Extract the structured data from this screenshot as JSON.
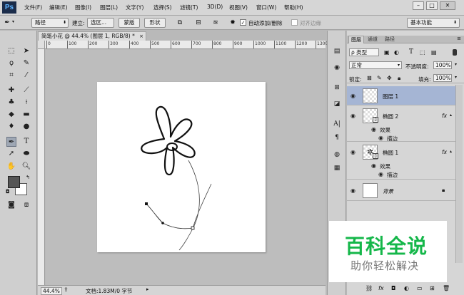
{
  "app": {
    "logo": "Ps"
  },
  "menu": [
    "文件(F)",
    "编辑(E)",
    "图像(I)",
    "图层(L)",
    "文字(Y)",
    "选择(S)",
    "滤镜(T)",
    "3D(D)",
    "视图(V)",
    "窗口(W)",
    "帮助(H)"
  ],
  "window_buttons": {
    "minimize": "–",
    "maximize": "□",
    "close": "✕"
  },
  "options": {
    "tool_mode": "路径",
    "build_label": "建立:",
    "selection_button": "选区...",
    "mask_button": "蒙版",
    "shape_button": "形状",
    "auto_add_delete": "自动添加/删除",
    "align_edges": "对齐边缘",
    "workspace": "基本功能"
  },
  "document": {
    "tab_title": "简笔小花 @ 44.4% (图层 1, RGB/8) *",
    "close": "×",
    "ruler_ticks": [
      "0",
      "100",
      "200",
      "300",
      "400",
      "500",
      "600",
      "700",
      "800",
      "900",
      "1000",
      "1100",
      "1200",
      "1300"
    ]
  },
  "status": {
    "zoom": "44.4%",
    "doc_info": "文档:1.83M/0 字节"
  },
  "layers_panel": {
    "tabs": [
      "图层",
      "通道",
      "路径"
    ],
    "filter_kind": "类型",
    "blend_mode": "正常",
    "opacity_label": "不透明度:",
    "opacity": "100%",
    "lock_label": "锁定:",
    "fill_label": "填充:",
    "fill": "100%",
    "layers": [
      {
        "name": "图层 1",
        "selected": true
      },
      {
        "name": "椭圆 2",
        "fx": "fx",
        "effects_label": "效果",
        "effect": "描边"
      },
      {
        "name": "椭圆 1",
        "fx": "fx",
        "effects_label": "效果",
        "effect": "描边"
      },
      {
        "name": "背景"
      }
    ]
  },
  "watermark": {
    "title": "百科全说",
    "subtitle": "助你轻松解决"
  },
  "colors": {
    "accent_selected_layer": "#a5b5d4",
    "watermark_green": "#15b74a"
  }
}
